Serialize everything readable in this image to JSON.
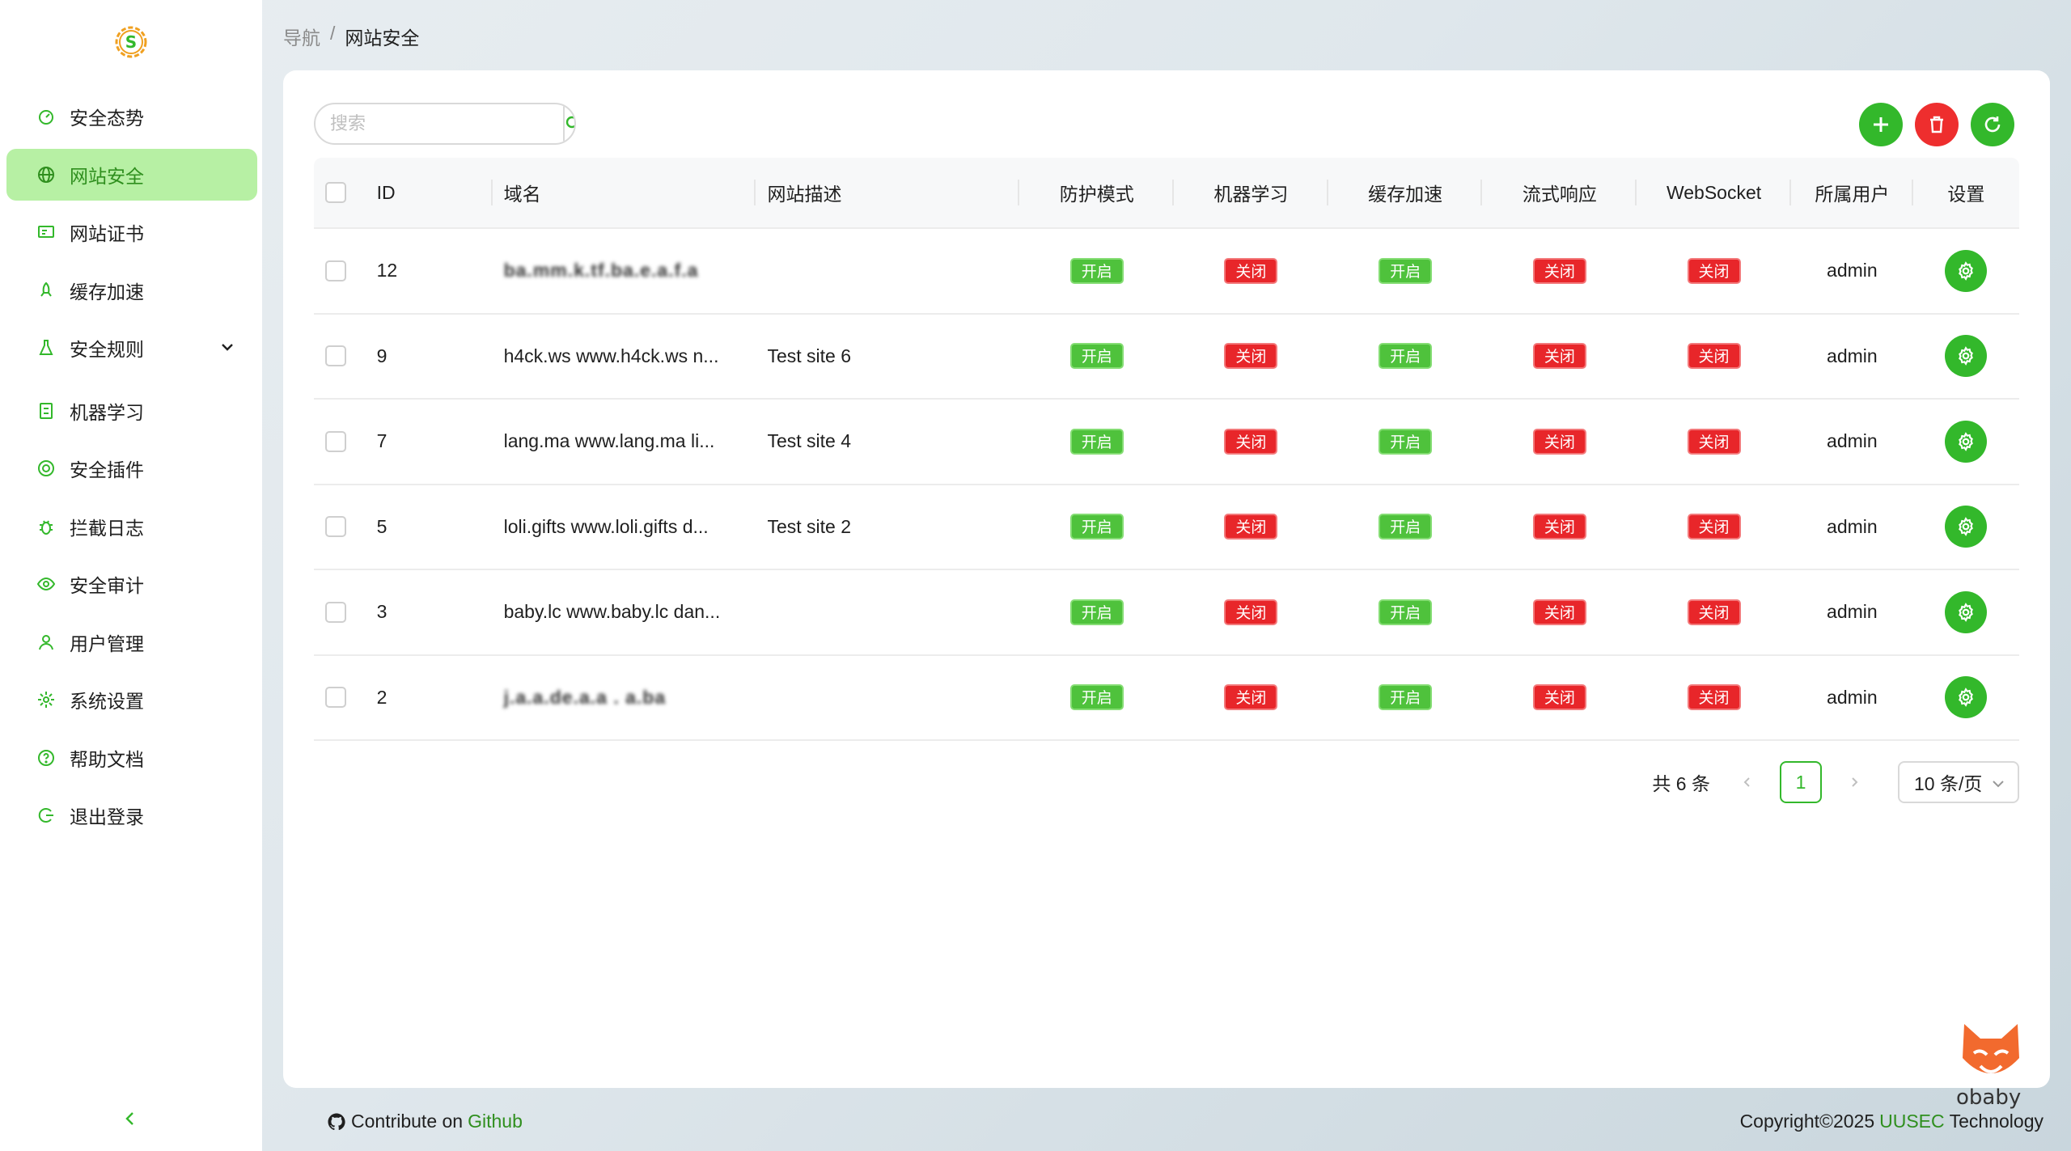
{
  "colors": {
    "accent": "#33b82b",
    "danger": "#ee2e2e",
    "active_bg": "#b7f0a4",
    "link": "#2f8f1e"
  },
  "sidebar": {
    "logo_letter": "S",
    "items": [
      {
        "label": "安全态势",
        "icon": "dashboard-icon"
      },
      {
        "label": "网站安全",
        "icon": "globe-icon",
        "active": true
      },
      {
        "label": "网站证书",
        "icon": "certificate-icon"
      },
      {
        "label": "缓存加速",
        "icon": "rocket-icon"
      },
      {
        "label": "安全规则",
        "icon": "flask-icon",
        "expandable": true
      },
      {
        "label": "机器学习",
        "icon": "robot-icon"
      },
      {
        "label": "安全插件",
        "icon": "plugin-icon"
      },
      {
        "label": "拦截日志",
        "icon": "bug-icon"
      },
      {
        "label": "安全审计",
        "icon": "eye-icon"
      },
      {
        "label": "用户管理",
        "icon": "user-icon"
      },
      {
        "label": "系统设置",
        "icon": "gear-icon"
      },
      {
        "label": "帮助文档",
        "icon": "question-icon"
      },
      {
        "label": "退出登录",
        "icon": "logout-icon"
      }
    ]
  },
  "breadcrumb": {
    "root": "导航",
    "separator": "/",
    "current": "网站安全"
  },
  "search": {
    "placeholder": "搜索",
    "value": ""
  },
  "table": {
    "headers": {
      "id": "ID",
      "domain": "域名",
      "desc": "网站描述",
      "mode": "防护模式",
      "ml": "机器学习",
      "cache": "缓存加速",
      "flow": "流式响应",
      "websocket": "WebSocket",
      "user": "所属用户",
      "settings": "设置"
    },
    "on_label": "开启",
    "off_label": "关闭",
    "rows": [
      {
        "id": "12",
        "domain": "ba.mm.k.tf.ba.e.a.f.a",
        "domain_blurred": true,
        "desc": "",
        "mode": "开启",
        "ml": "关闭",
        "cache": "开启",
        "flow": "关闭",
        "ws": "关闭",
        "user": "admin"
      },
      {
        "id": "9",
        "domain": "h4ck.ws www.h4ck.ws n...",
        "desc": "Test site 6",
        "mode": "开启",
        "ml": "关闭",
        "cache": "开启",
        "flow": "关闭",
        "ws": "关闭",
        "user": "admin"
      },
      {
        "id": "7",
        "domain": "lang.ma www.lang.ma li...",
        "desc": "Test site 4",
        "mode": "开启",
        "ml": "关闭",
        "cache": "开启",
        "flow": "关闭",
        "ws": "关闭",
        "user": "admin"
      },
      {
        "id": "5",
        "domain": "loli.gifts www.loli.gifts d...",
        "desc": "Test site 2",
        "mode": "开启",
        "ml": "关闭",
        "cache": "开启",
        "flow": "关闭",
        "ws": "关闭",
        "user": "admin"
      },
      {
        "id": "3",
        "domain": "baby.lc www.baby.lc dan...",
        "desc": "",
        "mode": "开启",
        "ml": "关闭",
        "cache": "开启",
        "flow": "关闭",
        "ws": "关闭",
        "user": "admin"
      },
      {
        "id": "2",
        "domain": "j.a.a.de.a.a . a.ba",
        "domain_blurred": true,
        "desc": "",
        "mode": "开启",
        "ml": "关闭",
        "cache": "开启",
        "flow": "关闭",
        "ws": "关闭",
        "user": "admin"
      }
    ]
  },
  "pagination": {
    "total": "共 6 条",
    "current": "1",
    "page_size": "10 条/页"
  },
  "footer": {
    "contribute_text": "Contribute on",
    "contribute_link": "Github",
    "copyright_prefix": "Copyright©2025",
    "company": "UUSEC",
    "company_suffix": "Technology"
  },
  "watermark": {
    "text": "obaby"
  }
}
